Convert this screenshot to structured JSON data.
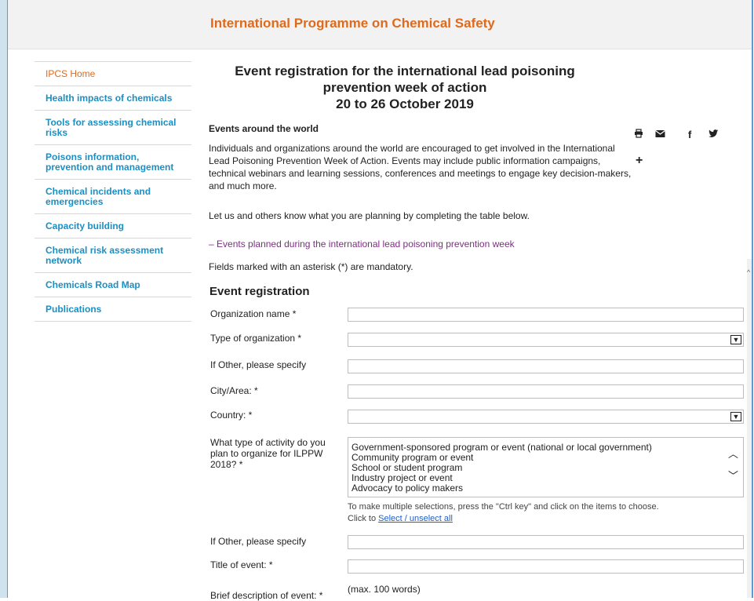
{
  "header": {
    "title": "International Programme on Chemical Safety"
  },
  "sidebar": {
    "items": [
      {
        "label": "IPCS Home"
      },
      {
        "label": "Health impacts of chemicals"
      },
      {
        "label": "Tools for assessing chemical risks"
      },
      {
        "label": "Poisons information, prevention and management"
      },
      {
        "label": "Chemical incidents and emergencies"
      },
      {
        "label": "Capacity building"
      },
      {
        "label": "Chemical risk assessment network"
      },
      {
        "label": "Chemicals Road Map"
      },
      {
        "label": "Publications"
      }
    ]
  },
  "main": {
    "title_line1": "Event registration for the international lead poisoning",
    "title_line2": "prevention week of action",
    "title_line3": "20 to 26 October 2019",
    "section_heading": "Events around the world",
    "paragraph1": "Individuals and organizations around the world are encouraged to get involved in the International Lead Poisoning Prevention Week of Action. Events may include public information campaigns, technical webinars and learning sessions, conferences and meetings to engage key decision-makers, and much more.",
    "paragraph2": "Let us and others know what you are planning by completing the table below.",
    "accordion_label": "Events planned during the international lead poisoning prevention week",
    "mandatory_note": "Fields marked with an asterisk (*) are mandatory."
  },
  "share": {
    "icons": [
      "print-icon",
      "email-icon",
      "facebook-icon",
      "twitter-icon",
      "plus-icon"
    ]
  },
  "form": {
    "title": "Event registration",
    "org_name_label": "Organization name *",
    "org_type_label": "Type of organization  *",
    "other1_label": "If Other, please specify",
    "city_label": "City/Area: *",
    "country_label": "Country: *",
    "activity_label": "What type of activity do you plan to organize for ILPPW 2018?  *",
    "activity_options": [
      "Government-sponsored program or event (national or local government)",
      "Community program or event",
      "School or student program",
      "Industry project or event",
      "Advocacy to policy makers"
    ],
    "help_text": "To make multiple selections, press the \"Ctrl key\" and click on the items to choose.",
    "click_to": "Click to",
    "select_all": "Select / unselect all",
    "other2_label": "If Other, please specify",
    "event_title_label": "Title of event: *",
    "description_label": "Brief description of event: *",
    "max_words": "(max. 100 words)"
  }
}
